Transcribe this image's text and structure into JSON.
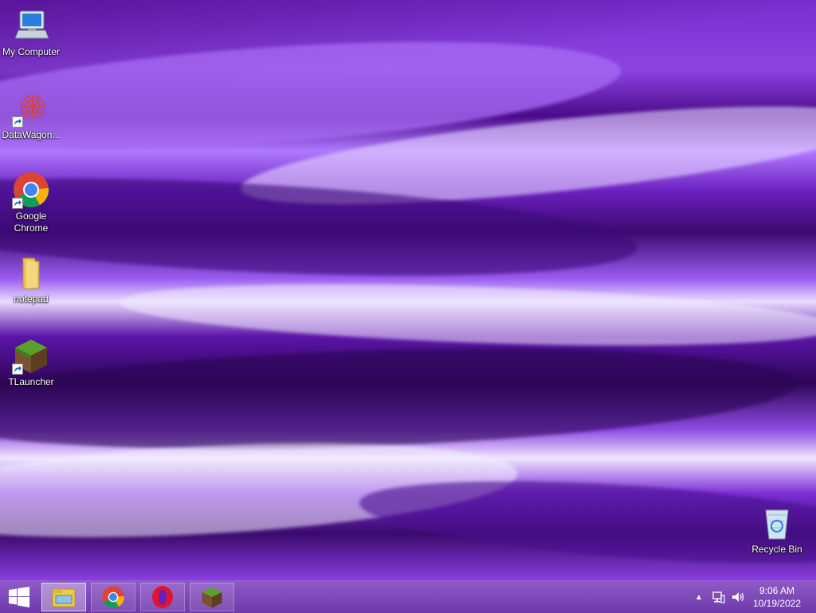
{
  "desktop": {
    "icons": [
      {
        "label": "My Computer",
        "icon": "computer-icon"
      },
      {
        "label": "DataWagon...",
        "icon": "datawagon-icon"
      },
      {
        "label": "Google\nChrome",
        "icon": "chrome-icon"
      },
      {
        "label": "notepad",
        "icon": "folder-icon"
      },
      {
        "label": "TLauncher",
        "icon": "tlauncher-icon"
      },
      {
        "label": "Recycle Bin",
        "icon": "recycle-bin-icon"
      }
    ]
  },
  "taskbar": {
    "start_icon": "windows-icon",
    "pinned": [
      {
        "name": "File Explorer",
        "icon": "file-explorer-icon",
        "active": true
      },
      {
        "name": "Google Chrome",
        "icon": "chrome-icon",
        "active": false
      },
      {
        "name": "Opera",
        "icon": "opera-icon",
        "active": false
      },
      {
        "name": "TLauncher",
        "icon": "tlauncher-icon",
        "active": false
      }
    ],
    "tray": {
      "show_hidden_icon": "chevron-up-icon",
      "network_icon": "network-icon",
      "volume_icon": "volume-icon",
      "time": "9:06 AM",
      "date": "10/19/2022"
    }
  },
  "colors": {
    "wallpaper_base": "#6a1fb8",
    "taskbar": "#8a4fc4"
  }
}
